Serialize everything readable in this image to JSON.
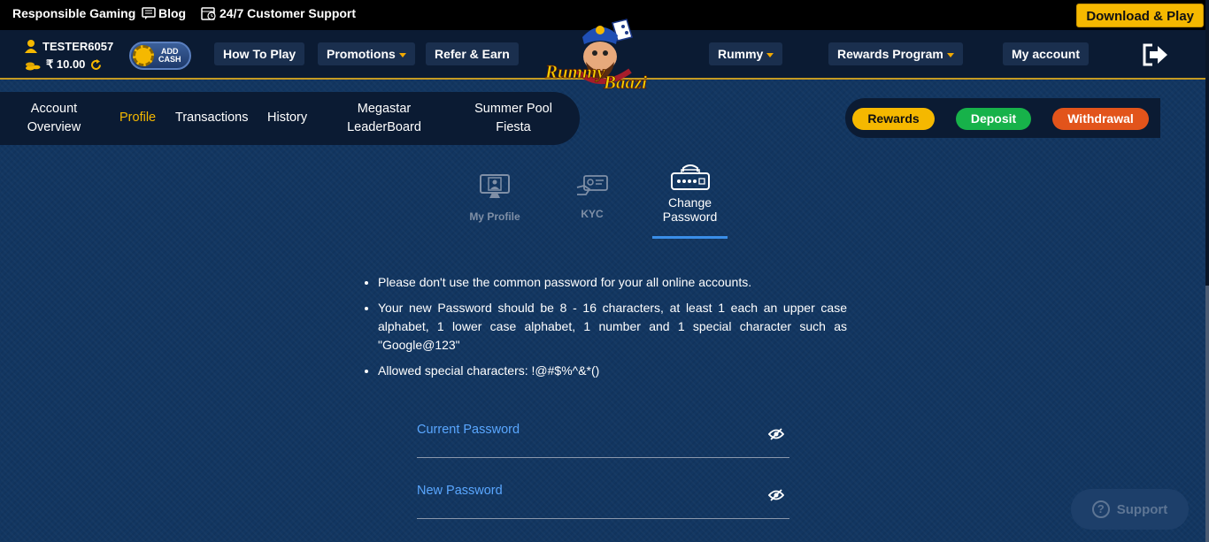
{
  "topbar": {
    "responsible_gaming": "Responsible Gaming",
    "blog": "Blog",
    "support": "24/7 Customer Support",
    "download": "Download & Play"
  },
  "user": {
    "name": "TESTER6057",
    "balance": "₹ 10.00"
  },
  "add_cash": {
    "line1": "ADD",
    "line2": "CASH"
  },
  "logo": {
    "line1": "Rummy",
    "line2": "Baazi"
  },
  "nav": {
    "how_to_play": "How To Play",
    "promotions": "Promotions",
    "refer_earn": "Refer & Earn",
    "rummy": "Rummy",
    "rewards_program": "Rewards Program",
    "my_account": "My account"
  },
  "subnav": {
    "account_overview_1": "Account",
    "account_overview_2": "Overview",
    "profile": "Profile",
    "transactions": "Transactions",
    "history": "History",
    "megastar_1": "Megastar",
    "megastar_2": "LeaderBoard",
    "summer_1": "Summer Pool",
    "summer_2": "Fiesta"
  },
  "actions": {
    "rewards": "Rewards",
    "deposit": "Deposit",
    "withdrawal": "Withdrawal"
  },
  "tabs": {
    "my_profile": "My Profile",
    "kyc": "KYC",
    "change_password_1": "Change",
    "change_password_2": "Password"
  },
  "rules": [
    "Please don't use the common password for your all online accounts.",
    "Your new Password should be 8 - 16 characters, at least 1 each an upper case alphabet, 1 lower case alphabet, 1 number and 1 special character such as \"Google@123\"",
    "Allowed special characters: !@#$%^&*()"
  ],
  "form": {
    "current_password": "Current Password",
    "new_password": "New Password"
  },
  "support_widget": "Support",
  "colors": {
    "accent": "#f5b800",
    "deposit": "#17b24a",
    "withdrawal": "#e2541b",
    "link": "#5aa7ff"
  }
}
